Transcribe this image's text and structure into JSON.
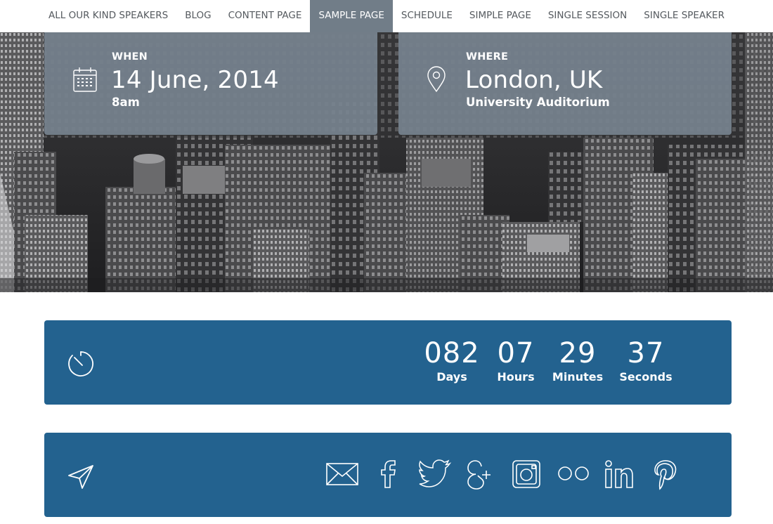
{
  "nav": {
    "items": [
      {
        "label": "ALL OUR KIND SPEAKERS",
        "active": false
      },
      {
        "label": "BLOG",
        "active": false
      },
      {
        "label": "CONTENT PAGE",
        "active": false
      },
      {
        "label": "SAMPLE PAGE",
        "active": true
      },
      {
        "label": "SCHEDULE",
        "active": false
      },
      {
        "label": "SIMPLE PAGE",
        "active": false
      },
      {
        "label": "SINGLE SESSION",
        "active": false
      },
      {
        "label": "SINGLE SPEAKER",
        "active": false
      }
    ]
  },
  "event": {
    "when": {
      "label": "WHEN",
      "date": "14 June, 2014",
      "time": "8am",
      "icon": "calendar-icon"
    },
    "where": {
      "label": "WHERE",
      "city": "London, UK",
      "venue": "University Auditorium",
      "icon": "map-pin-icon"
    }
  },
  "countdown": {
    "icon": "timer-icon",
    "units": [
      {
        "value": "082",
        "label": "Days"
      },
      {
        "value": "07",
        "label": "Hours"
      },
      {
        "value": "29",
        "label": "Minutes"
      },
      {
        "value": "37",
        "label": "Seconds"
      }
    ]
  },
  "social": {
    "icon": "send-icon",
    "links": [
      "email-icon",
      "facebook-icon",
      "twitter-icon",
      "google-plus-icon",
      "instagram-icon",
      "flickr-icon",
      "linkedin-icon",
      "pinterest-icon"
    ]
  },
  "colors": {
    "nav_active": "#717d88",
    "card_bg": "#76828e",
    "panel_bg": "#23628f"
  }
}
